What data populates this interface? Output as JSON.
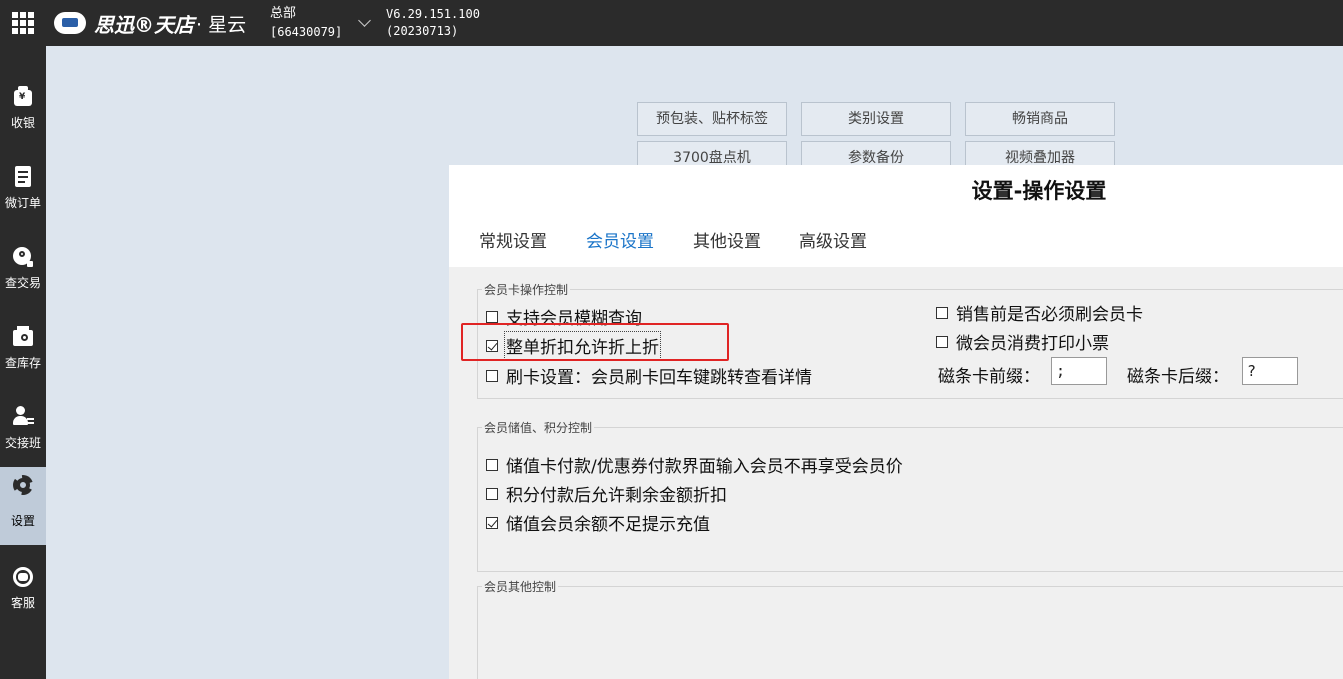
{
  "topbar": {
    "brand": "思迅®天店",
    "product": "· 星云",
    "store_name": "总部",
    "store_code": "[66430079]",
    "version": "V6.29.151.100",
    "build_date": "(20230713)"
  },
  "sidebar": {
    "items": [
      {
        "label": "收银",
        "icon": "cash-register-icon"
      },
      {
        "label": "微订单",
        "icon": "order-icon"
      },
      {
        "label": "查交易",
        "icon": "transaction-icon"
      },
      {
        "label": "查库存",
        "icon": "inventory-icon"
      },
      {
        "label": "交接班",
        "icon": "shift-handover-icon"
      },
      {
        "label": "设置",
        "icon": "gear-icon",
        "active": true
      },
      {
        "label": "客服",
        "icon": "support-icon"
      }
    ]
  },
  "background_buttons": [
    "预包装、贴杯标签",
    "类别设置",
    "畅销商品",
    "3700盘点机",
    "参数备份",
    "视频叠加器"
  ],
  "dialog": {
    "title": "设置-操作设置",
    "tabs": [
      {
        "label": "常规设置",
        "active": false
      },
      {
        "label": "会员设置",
        "active": true
      },
      {
        "label": "其他设置",
        "active": false
      },
      {
        "label": "高级设置",
        "active": false
      }
    ],
    "groups": {
      "card_control": {
        "title": "会员卡操作控制",
        "options": [
          {
            "label": "支持会员模糊查询",
            "checked": false
          },
          {
            "label": "整单折扣允许折上折",
            "checked": true
          },
          {
            "label": "刷卡设置：会员刷卡回车键跳转查看详情",
            "checked": false
          },
          {
            "label": "销售前是否必须刷会员卡",
            "checked": false
          },
          {
            "label": "微会员消费打印小票",
            "checked": false
          }
        ],
        "prefix_label": "磁条卡前缀：",
        "prefix_value": ";",
        "suffix_label": "磁条卡后缀：",
        "suffix_value": "?"
      },
      "stored_value": {
        "title": "会员储值、积分控制",
        "options": [
          {
            "label": "储值卡付款/优惠券付款界面输入会员不再享受会员价",
            "checked": false
          },
          {
            "label": "积分付款后允许剩余金额折扣",
            "checked": false
          },
          {
            "label": "储值会员余额不足提示充值",
            "checked": true
          }
        ]
      },
      "other": {
        "title": "会员其他控制"
      }
    }
  },
  "colors": {
    "topbar": "#2b2b2b",
    "active_tab": "#1a74c8",
    "highlight": "#e02424"
  }
}
